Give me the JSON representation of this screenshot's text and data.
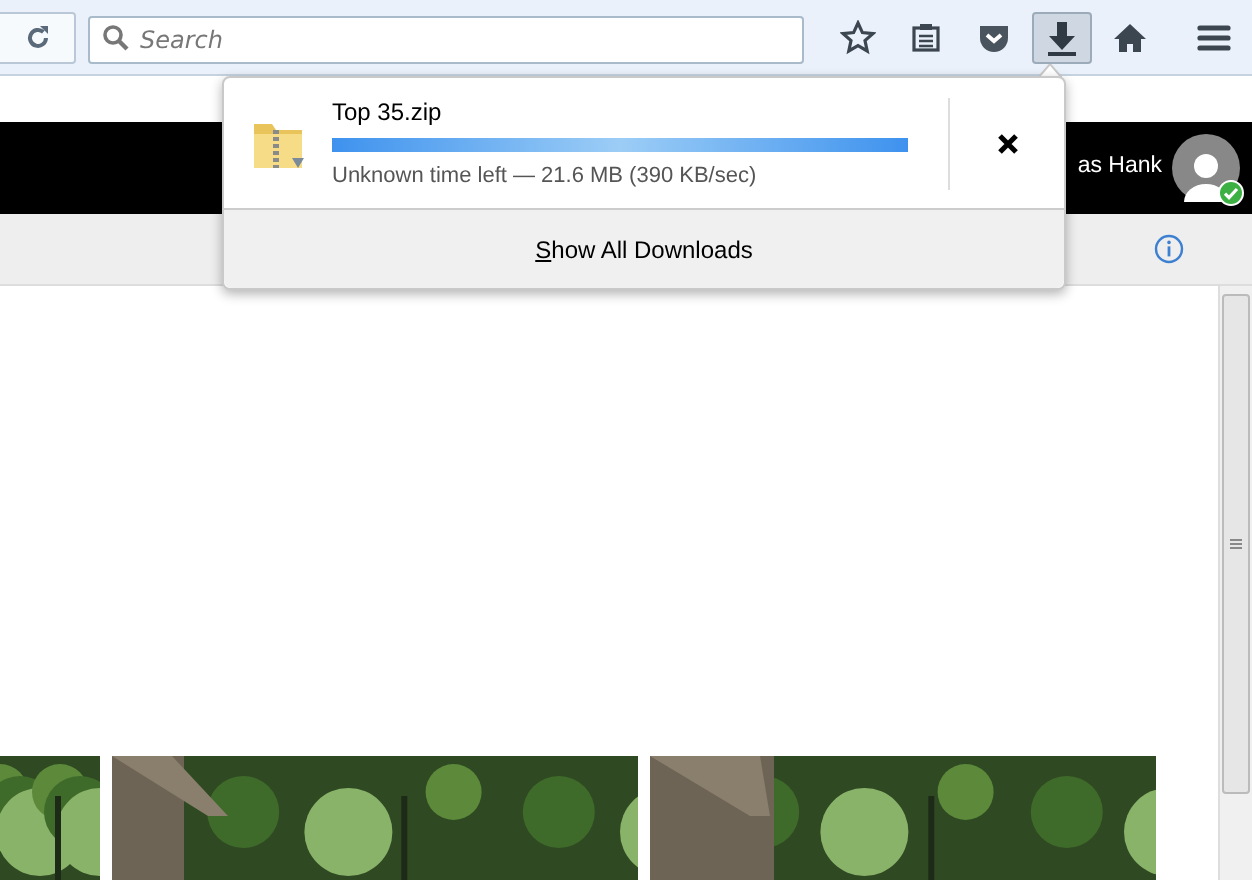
{
  "toolbar": {
    "search": {
      "placeholder": "Search"
    },
    "downloads_button": {
      "pressed": true
    }
  },
  "downloads_panel": {
    "items": [
      {
        "filename": "Top 35.zip",
        "level": 1,
        "status": "Unknown time left — 21.6 MB (390 KB/sec)"
      }
    ],
    "footer": "Show All Downloads"
  },
  "page_header": {
    "user_name": "as Hank",
    "online": true
  }
}
